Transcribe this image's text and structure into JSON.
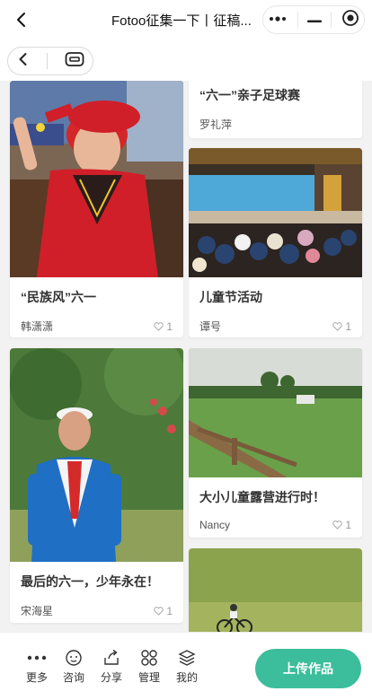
{
  "nav": {
    "title": "Fotoo征集一下丨征稿..."
  },
  "cards": [
    {
      "title": "“民族风”六一",
      "author": "韩潇潇",
      "likes": "1"
    },
    {
      "title": "“六一”亲子足球赛",
      "author": "罗礼萍"
    },
    {
      "title": "儿童节活动",
      "author": "谭号",
      "likes": "1"
    },
    {
      "title": "最后的六一，少年永在！",
      "author": "宋海星",
      "likes": "1"
    },
    {
      "title": "大小儿童露营进行时！",
      "author": "Nancy",
      "likes": "1"
    }
  ],
  "toolbar": {
    "more": "更多",
    "consult": "咨询",
    "share": "分享",
    "manage": "管理",
    "mine": "我的",
    "upload": "上传作品"
  },
  "colors": {
    "accent": "#3cbd9b"
  },
  "icons": [
    "back-icon",
    "more-dots-icon",
    "minus-icon",
    "target-icon",
    "chevron-left-icon",
    "tv-icon",
    "heart-icon",
    "chat-icon",
    "share-icon",
    "grid-icon",
    "layers-icon"
  ]
}
